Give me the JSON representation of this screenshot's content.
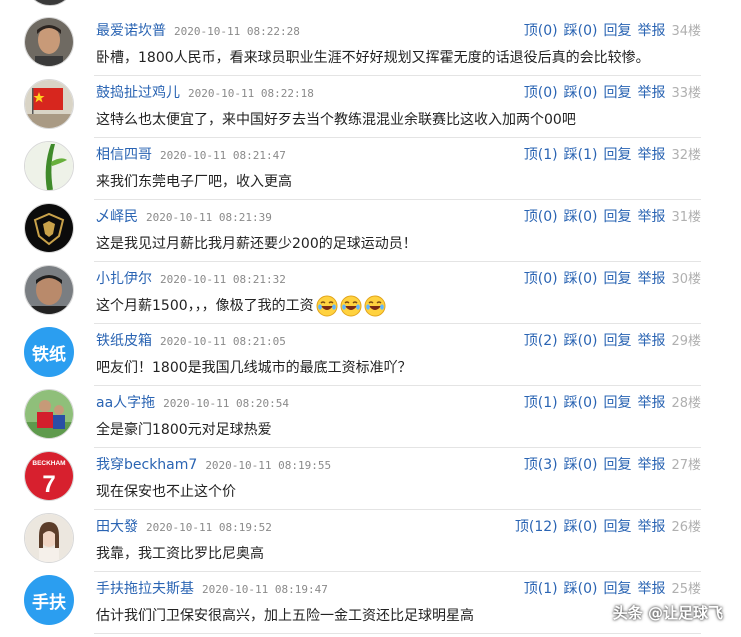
{
  "comments": [
    {
      "user": "最爱诺坎普",
      "time": "2020-10-11 08:22:28",
      "up": "顶(0)",
      "down": "踩(0)",
      "reply": "回复",
      "report": "举报",
      "floor": "34楼",
      "text": "卧槽，1800人民币，看来球员职业生涯不好好规划又挥霍无度的话退役后真的会比较惨。",
      "avatar": "photo-man-avatar"
    },
    {
      "user": "鼓捣扯过鸡儿",
      "time": "2020-10-11 08:22:18",
      "up": "顶(0)",
      "down": "踩(0)",
      "reply": "回复",
      "report": "举报",
      "floor": "33楼",
      "text": "这特么也太便宜了，来中国好歹去当个教练混混业余联赛比这收入加两个00吧",
      "avatar": "flag-avatar"
    },
    {
      "user": "相信四哥",
      "time": "2020-10-11 08:21:47",
      "up": "顶(1)",
      "down": "踩(1)",
      "reply": "回复",
      "report": "举报",
      "floor": "32楼",
      "text": "来我们东莞电子厂吧，收入更高",
      "avatar": "plant-avatar"
    },
    {
      "user": "乄峄民",
      "time": "2020-10-11 08:21:39",
      "up": "顶(0)",
      "down": "踩(0)",
      "reply": "回复",
      "report": "举报",
      "floor": "31楼",
      "text": "这是我见过月薪比我月薪还要少200的足球运动员！",
      "avatar": "logo-avatar"
    },
    {
      "user": "小扎伊尔",
      "time": "2020-10-11 08:21:32",
      "up": "顶(0)",
      "down": "踩(0)",
      "reply": "回复",
      "report": "举报",
      "floor": "30楼",
      "text": "这个月薪1500，，，像极了我的工资",
      "emojis": 3,
      "avatar": "photo-man2-avatar"
    },
    {
      "user": "铁纸皮箱",
      "time": "2020-10-11 08:21:05",
      "up": "顶(2)",
      "down": "踩(0)",
      "reply": "回复",
      "report": "举报",
      "floor": "29楼",
      "text": "吧友们！1800是我国几线城市的最底工资标准吖？",
      "avatar_text": "铁纸"
    },
    {
      "user": "aa人字拖",
      "time": "2020-10-11 08:20:54",
      "up": "顶(1)",
      "down": "踩(0)",
      "reply": "回复",
      "report": "举报",
      "floor": "28楼",
      "text": "全是豪门1800元对足球热爱",
      "avatar": "player-avatar"
    },
    {
      "user": "我穿beckham7",
      "time": "2020-10-11 08:19:55",
      "up": "顶(3)",
      "down": "踩(0)",
      "reply": "回复",
      "report": "举报",
      "floor": "27楼",
      "text": "现在保安也不止这个价",
      "avatar": "jersey-avatar",
      "jersey_name": "BECKHAM",
      "jersey_num": "7"
    },
    {
      "user": "田大發",
      "time": "2020-10-11 08:19:52",
      "up": "顶(12)",
      "down": "踩(0)",
      "reply": "回复",
      "report": "举报",
      "floor": "26楼",
      "text": "我靠，我工资比罗比尼奥高",
      "avatar": "girl-avatar"
    },
    {
      "user": "手扶拖拉夫斯基",
      "time": "2020-10-11 08:19:47",
      "up": "顶(1)",
      "down": "踩(0)",
      "reply": "回复",
      "report": "举报",
      "floor": "25楼",
      "text": "估计我们门卫保安很高兴，加上五险一金工资还比足球明星高",
      "avatar_text": "手扶"
    }
  ],
  "watermark": "头条 @让足球飞",
  "colors": {
    "link": "#2a64b3",
    "time": "#8a8a8a",
    "floor": "#b0b0b0",
    "text_avatar": "#2b9ef0"
  }
}
